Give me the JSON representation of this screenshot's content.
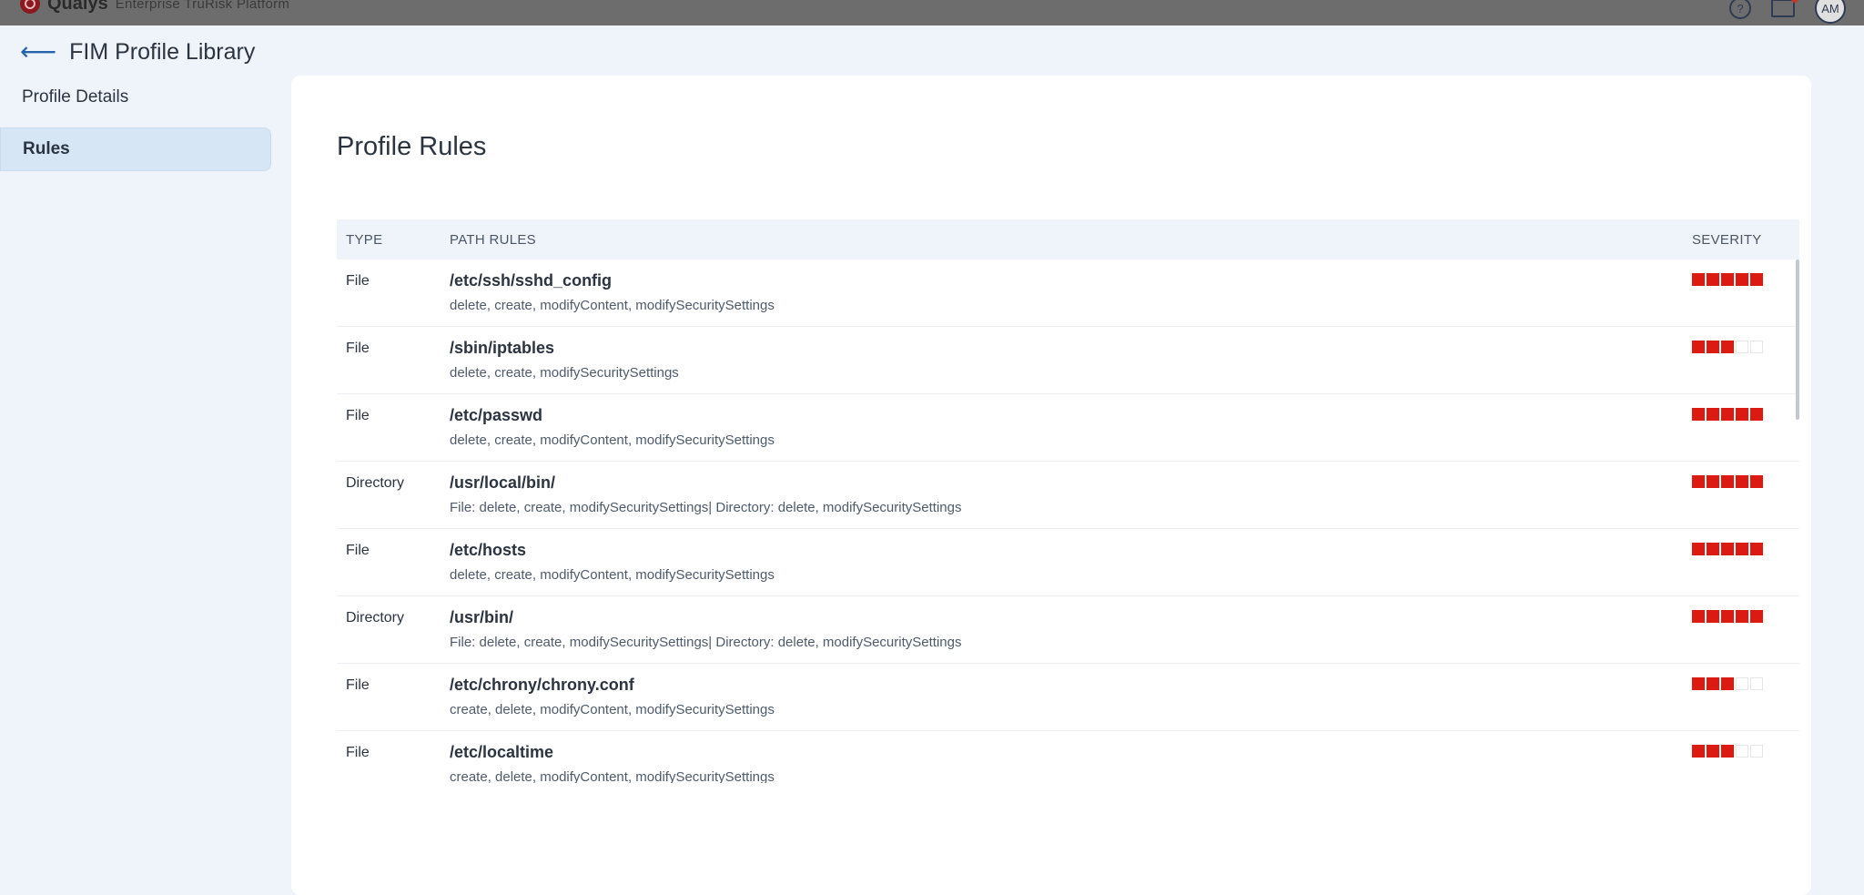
{
  "topbar": {
    "brand_name": "Qualys",
    "brand_sub": "Enterprise TruRisk Platform",
    "help_glyph": "?",
    "avatar_initials": "AM"
  },
  "header": {
    "title": "FIM Profile Library",
    "back_glyph": "⟵"
  },
  "sidebar": {
    "items": [
      {
        "label": "Profile Details",
        "active": false
      },
      {
        "label": "Rules",
        "active": true
      }
    ]
  },
  "main": {
    "title": "Profile Rules",
    "columns": {
      "type": "TYPE",
      "path": "PATH RULES",
      "severity": "SEVERITY"
    },
    "rows": [
      {
        "type": "File",
        "path": "/etc/ssh/sshd_config",
        "ops": "delete, create, modifyContent, modifySecuritySettings",
        "severity": 5
      },
      {
        "type": "File",
        "path": "/sbin/iptables",
        "ops": "delete, create, modifySecuritySettings",
        "severity": 3
      },
      {
        "type": "File",
        "path": "/etc/passwd",
        "ops": "delete, create, modifyContent, modifySecuritySettings",
        "severity": 5
      },
      {
        "type": "Directory",
        "path": "/usr/local/bin/",
        "ops": "File: delete, create, modifySecuritySettings| Directory: delete, modifySecuritySettings",
        "severity": 5
      },
      {
        "type": "File",
        "path": "/etc/hosts",
        "ops": "delete, create, modifyContent, modifySecuritySettings",
        "severity": 5
      },
      {
        "type": "Directory",
        "path": "/usr/bin/",
        "ops": "File: delete, create, modifySecuritySettings| Directory: delete, modifySecuritySettings",
        "severity": 5
      },
      {
        "type": "File",
        "path": "/etc/chrony/chrony.conf",
        "ops": "create, delete, modifyContent, modifySecuritySettings",
        "severity": 3
      },
      {
        "type": "File",
        "path": "/etc/localtime",
        "ops": "create, delete, modifyContent, modifySecuritySettings",
        "severity": 3
      }
    ],
    "severity_max": 5
  },
  "colors": {
    "severity_on": "#dd1a12",
    "accent": "#2563ab"
  }
}
